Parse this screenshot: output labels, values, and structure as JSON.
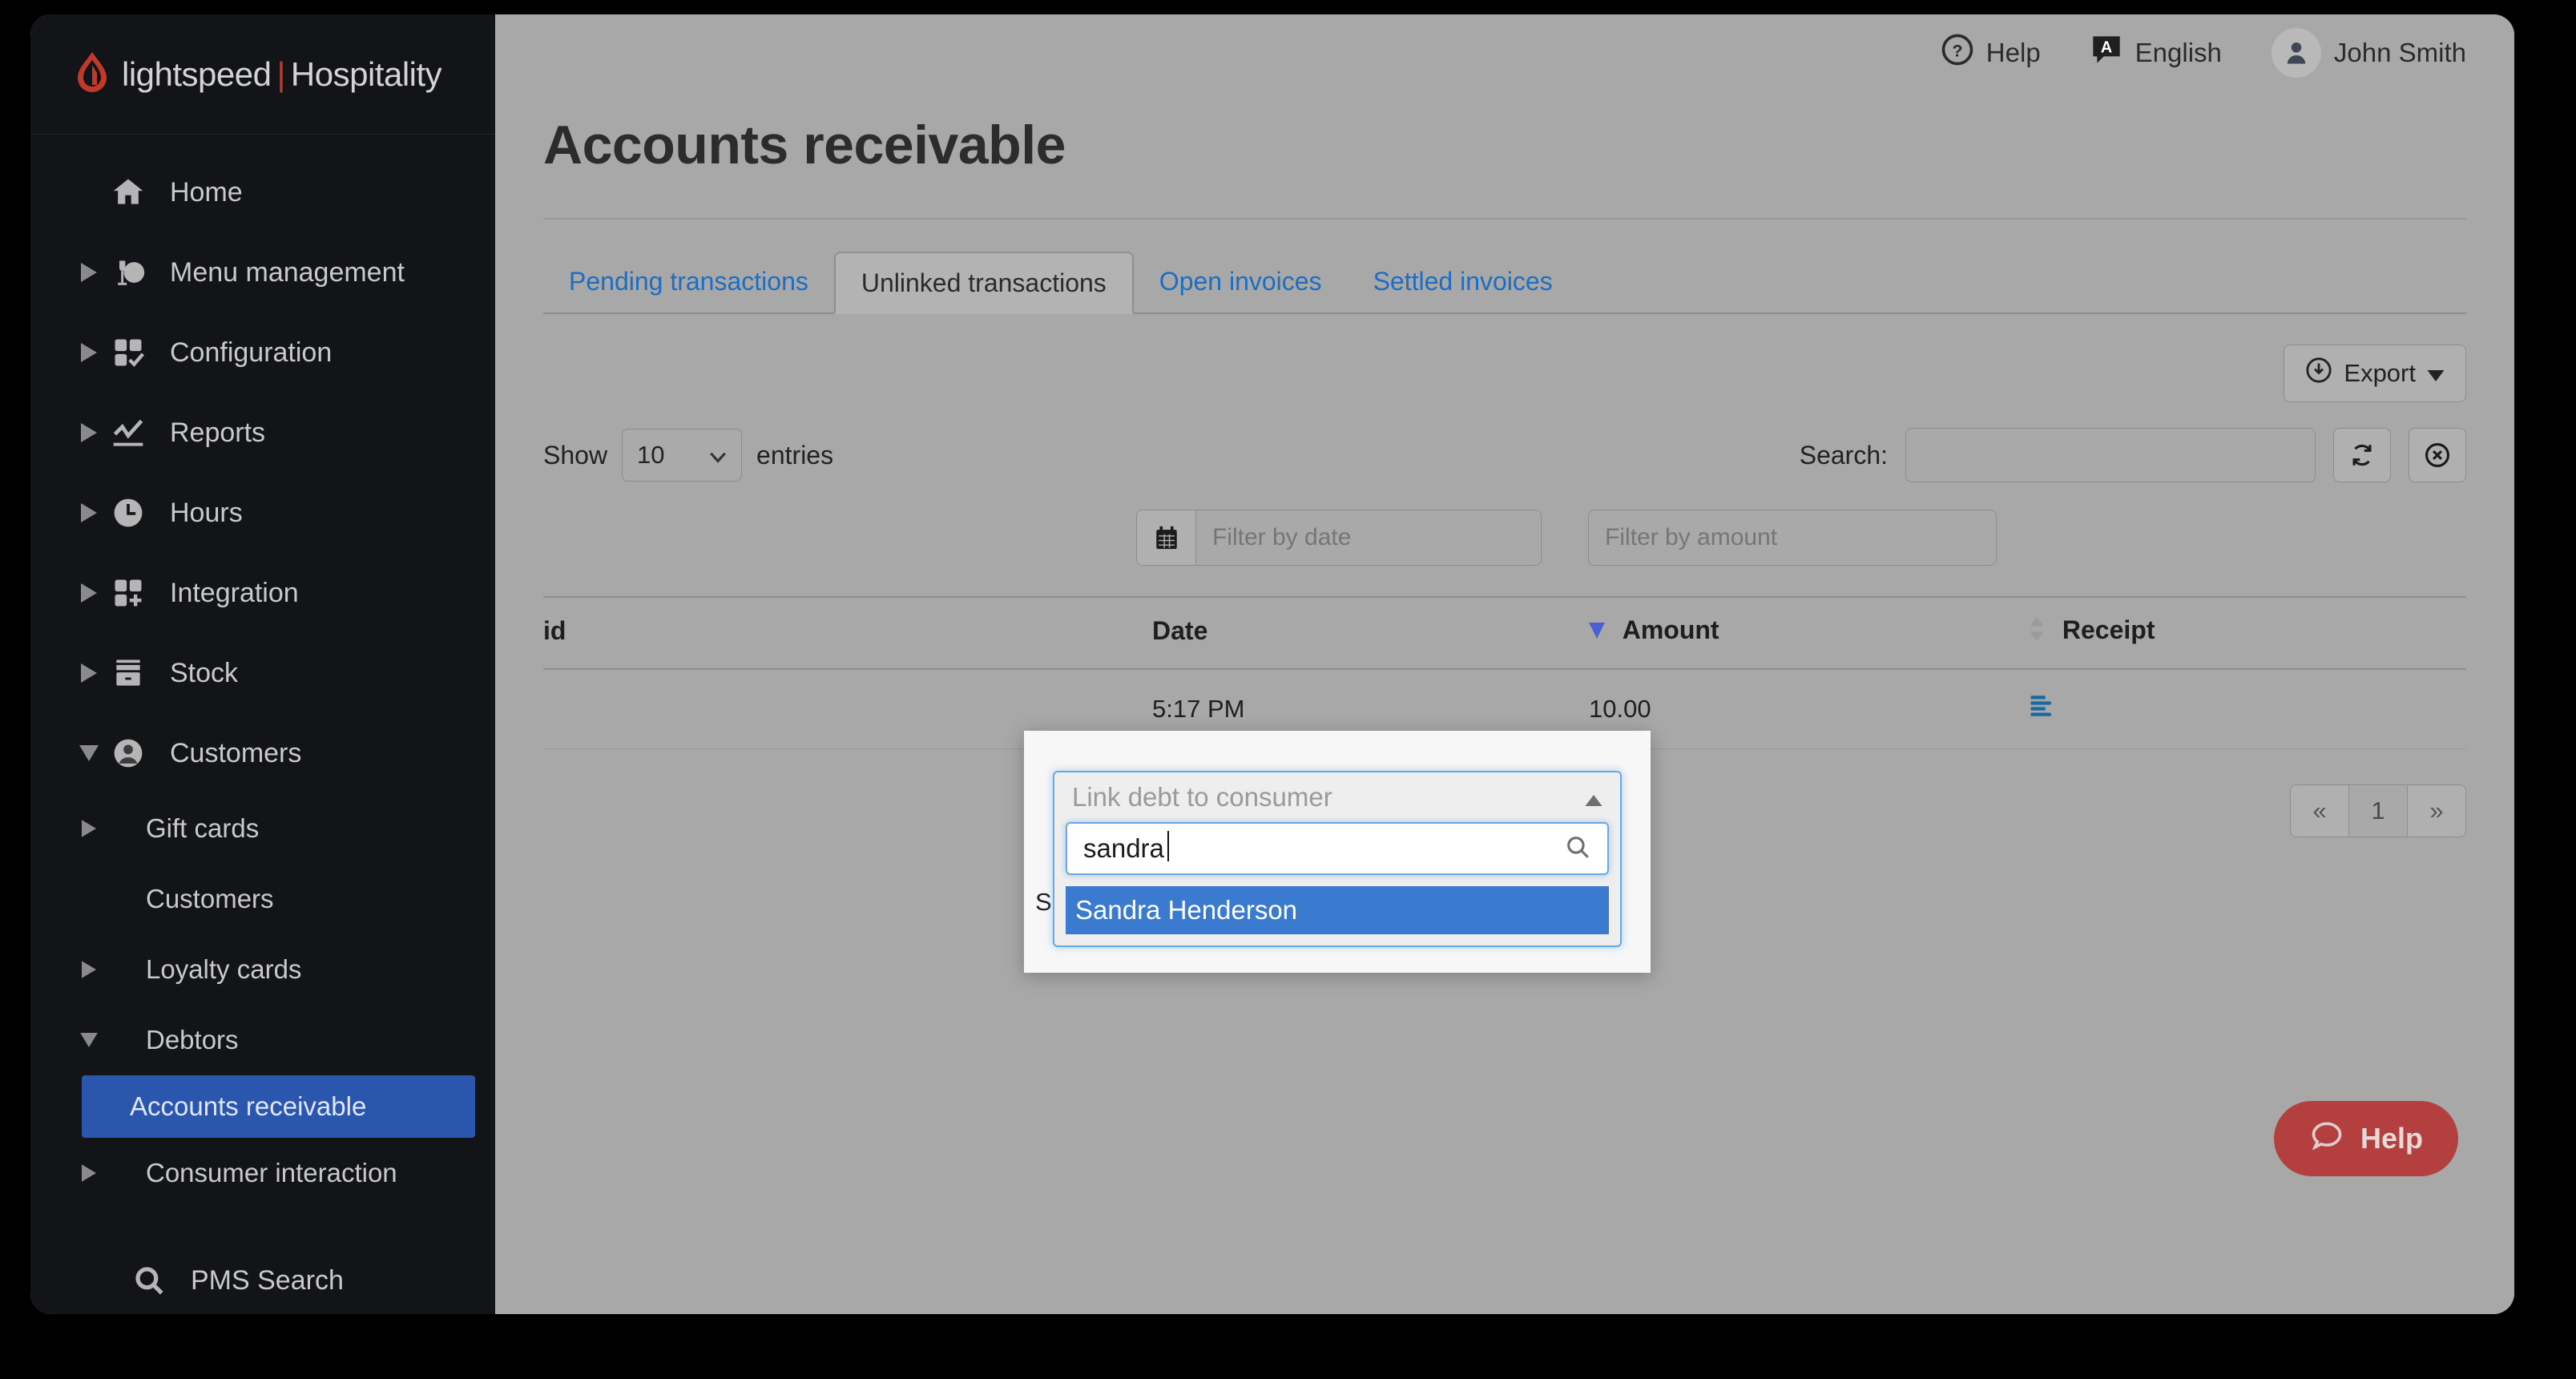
{
  "brand": {
    "name": "lightspeed",
    "separator": "|",
    "product": "Hospitality"
  },
  "topbar": {
    "help_label": "Help",
    "language_label": "English",
    "language_badge": "A",
    "user_name": "John Smith"
  },
  "sidebar": {
    "items": [
      {
        "label": "Home",
        "icon": "home-icon",
        "caret": "none"
      },
      {
        "label": "Menu management",
        "icon": "menu-management-icon",
        "caret": "right"
      },
      {
        "label": "Configuration",
        "icon": "configuration-icon",
        "caret": "right"
      },
      {
        "label": "Reports",
        "icon": "reports-chart-icon",
        "caret": "right"
      },
      {
        "label": "Hours",
        "icon": "clock-icon",
        "caret": "right"
      },
      {
        "label": "Integration",
        "icon": "integration-icon",
        "caret": "right"
      },
      {
        "label": "Stock",
        "icon": "stock-box-icon",
        "caret": "right"
      },
      {
        "label": "Customers",
        "icon": "user-circle-icon",
        "caret": "down"
      }
    ],
    "sub_items": [
      {
        "label": "Gift cards",
        "caret": "right",
        "active": false
      },
      {
        "label": "Customers",
        "caret": "none",
        "active": false
      },
      {
        "label": "Loyalty cards",
        "caret": "right",
        "active": false
      },
      {
        "label": "Debtors",
        "caret": "down",
        "active": false
      },
      {
        "label": "Accounts receivable",
        "caret": "none",
        "active": true
      },
      {
        "label": "Consumer interaction",
        "caret": "right",
        "active": false
      }
    ],
    "pms_search_label": "PMS Search",
    "active_color": "#2b56ad"
  },
  "page": {
    "title": "Accounts receivable"
  },
  "tabs": [
    {
      "label": "Pending transactions",
      "active": false
    },
    {
      "label": "Unlinked transactions",
      "active": true
    },
    {
      "label": "Open invoices",
      "active": false
    },
    {
      "label": "Settled invoices",
      "active": false
    }
  ],
  "toolbar": {
    "export_label": "Export"
  },
  "controls": {
    "show_label": "Show",
    "entries_label": "entries",
    "page_size": "10",
    "search_label": "Search:",
    "search_value": "",
    "search_placeholder": "",
    "refresh_title": "refresh",
    "clear_title": "clear"
  },
  "filters": {
    "date_placeholder": "Filter by date",
    "amount_placeholder": "Filter by amount"
  },
  "table": {
    "columns": [
      {
        "label": "id",
        "sort": "none"
      },
      {
        "label": "Date",
        "sort": "desc"
      },
      {
        "label": "Amount",
        "sort": "both"
      },
      {
        "label": "Receipt",
        "sort": "none"
      }
    ],
    "rows": [
      {
        "id": "",
        "date": "5:17 PM",
        "amount": "10.00",
        "receipt": "receipt-lines-icon"
      }
    ]
  },
  "pagination": {
    "prev": "«",
    "pages": [
      "1"
    ],
    "next": "»",
    "current": "1"
  },
  "popup": {
    "placeholder": "Link debt to consumer",
    "chevron": "up",
    "search_value": "sandra",
    "options": [
      {
        "label": "Sandra Henderson",
        "selected": true
      }
    ],
    "highlight_color": "#3a7bd0",
    "row_fragment": "S"
  },
  "help_fab": {
    "label": "Help",
    "color": "#b3403f"
  }
}
